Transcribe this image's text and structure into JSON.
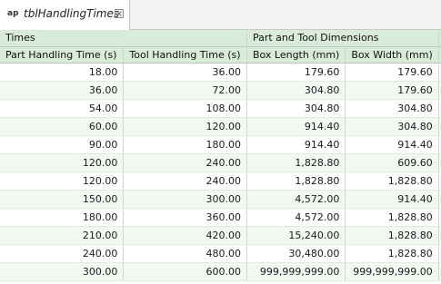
{
  "tab": {
    "icon": "ap",
    "title": "tblHandlingTimes"
  },
  "groups": [
    "Times",
    "Part and Tool Dimensions"
  ],
  "columns": [
    "Part Handling Time (s)",
    "Tool Handling Time (s)",
    "Box Length (mm)",
    "Box Width (mm)"
  ],
  "rows": [
    [
      "18.00",
      "36.00",
      "179.60",
      "179.60"
    ],
    [
      "36.00",
      "72.00",
      "304.80",
      "179.60"
    ],
    [
      "54.00",
      "108.00",
      "304.80",
      "304.80"
    ],
    [
      "60.00",
      "120.00",
      "914.40",
      "304.80"
    ],
    [
      "90.00",
      "180.00",
      "914.40",
      "914.40"
    ],
    [
      "120.00",
      "240.00",
      "1,828.80",
      "609.60"
    ],
    [
      "120.00",
      "240.00",
      "1,828.80",
      "1,828.80"
    ],
    [
      "150.00",
      "300.00",
      "4,572.00",
      "914.40"
    ],
    [
      "180.00",
      "360.00",
      "4,572.00",
      "1,828.80"
    ],
    [
      "210.00",
      "420.00",
      "15,240.00",
      "1,828.80"
    ],
    [
      "240.00",
      "480.00",
      "30,480.00",
      "1,828.80"
    ],
    [
      "300.00",
      "600.00",
      "999,999,999.00",
      "999,999,999.00"
    ]
  ]
}
